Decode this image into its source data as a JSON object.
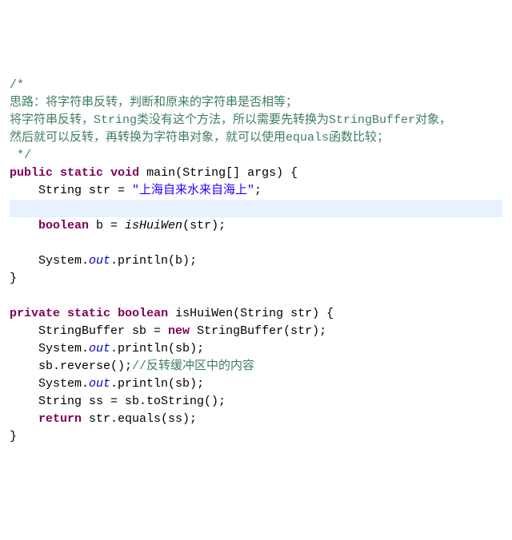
{
  "lines": [
    {
      "cls": "",
      "segs": [
        {
          "style": "comment-green",
          "t": "/*"
        }
      ]
    },
    {
      "cls": "",
      "segs": [
        {
          "style": "comment-green",
          "t": "思路：将字符串反转，判断和原来的字符串是否相等；"
        }
      ]
    },
    {
      "cls": "",
      "segs": [
        {
          "style": "comment-green",
          "t": "将字符串反转，String类没有这个方法，所以需要先转换为StringBuffer对象，"
        }
      ]
    },
    {
      "cls": "",
      "segs": [
        {
          "style": "comment-green",
          "t": "然后就可以反转，再转换为字符串对象，就可以使用equals函数比较；"
        }
      ]
    },
    {
      "cls": "",
      "segs": [
        {
          "style": "comment-green",
          "t": " */"
        }
      ]
    },
    {
      "cls": "",
      "segs": [
        {
          "style": "keyword",
          "t": "public"
        },
        {
          "style": "plain",
          "t": " "
        },
        {
          "style": "keyword",
          "t": "static"
        },
        {
          "style": "plain",
          "t": " "
        },
        {
          "style": "keyword",
          "t": "void"
        },
        {
          "style": "plain",
          "t": " main(String[] args) {"
        }
      ]
    },
    {
      "cls": "",
      "segs": [
        {
          "style": "plain",
          "t": "    String str = "
        },
        {
          "style": "string-lit",
          "t": "\"上海自来水来自海上\""
        },
        {
          "style": "plain",
          "t": ";"
        }
      ]
    },
    {
      "cls": "highlight",
      "segs": [
        {
          "style": "plain",
          "t": "    "
        }
      ]
    },
    {
      "cls": "",
      "segs": [
        {
          "style": "plain",
          "t": "    "
        },
        {
          "style": "keyword",
          "t": "boolean"
        },
        {
          "style": "plain",
          "t": " b = "
        },
        {
          "style": "method-call-italic",
          "t": "isHuiWen"
        },
        {
          "style": "plain",
          "t": "(str);"
        }
      ]
    },
    {
      "cls": "",
      "segs": [
        {
          "style": "plain",
          "t": ""
        }
      ]
    },
    {
      "cls": "",
      "segs": [
        {
          "style": "plain",
          "t": "    System."
        },
        {
          "style": "field-static",
          "t": "out"
        },
        {
          "style": "plain",
          "t": ".println(b);"
        }
      ]
    },
    {
      "cls": "",
      "segs": [
        {
          "style": "plain",
          "t": "}"
        }
      ]
    },
    {
      "cls": "",
      "segs": [
        {
          "style": "plain",
          "t": ""
        }
      ]
    },
    {
      "cls": "",
      "segs": [
        {
          "style": "keyword",
          "t": "private"
        },
        {
          "style": "plain",
          "t": " "
        },
        {
          "style": "keyword",
          "t": "static"
        },
        {
          "style": "plain",
          "t": " "
        },
        {
          "style": "keyword",
          "t": "boolean"
        },
        {
          "style": "plain",
          "t": " isHuiWen(String str) {"
        }
      ]
    },
    {
      "cls": "",
      "segs": [
        {
          "style": "plain",
          "t": "    StringBuffer sb = "
        },
        {
          "style": "keyword",
          "t": "new"
        },
        {
          "style": "plain",
          "t": " StringBuffer(str);"
        }
      ]
    },
    {
      "cls": "",
      "segs": [
        {
          "style": "plain",
          "t": "    System."
        },
        {
          "style": "field-static",
          "t": "out"
        },
        {
          "style": "plain",
          "t": ".println(sb);"
        }
      ]
    },
    {
      "cls": "",
      "segs": [
        {
          "style": "plain",
          "t": "    sb.reverse();"
        },
        {
          "style": "comment-green",
          "t": "//反转缓冲区中的内容"
        }
      ]
    },
    {
      "cls": "",
      "segs": [
        {
          "style": "plain",
          "t": "    System."
        },
        {
          "style": "field-static",
          "t": "out"
        },
        {
          "style": "plain",
          "t": ".println(sb);"
        }
      ]
    },
    {
      "cls": "",
      "segs": [
        {
          "style": "plain",
          "t": "    String ss = sb.toString();"
        }
      ]
    },
    {
      "cls": "",
      "segs": [
        {
          "style": "plain",
          "t": "    "
        },
        {
          "style": "keyword",
          "t": "return"
        },
        {
          "style": "plain",
          "t": " str.equals(ss);"
        }
      ]
    },
    {
      "cls": "",
      "segs": [
        {
          "style": "plain",
          "t": "}"
        }
      ]
    }
  ]
}
